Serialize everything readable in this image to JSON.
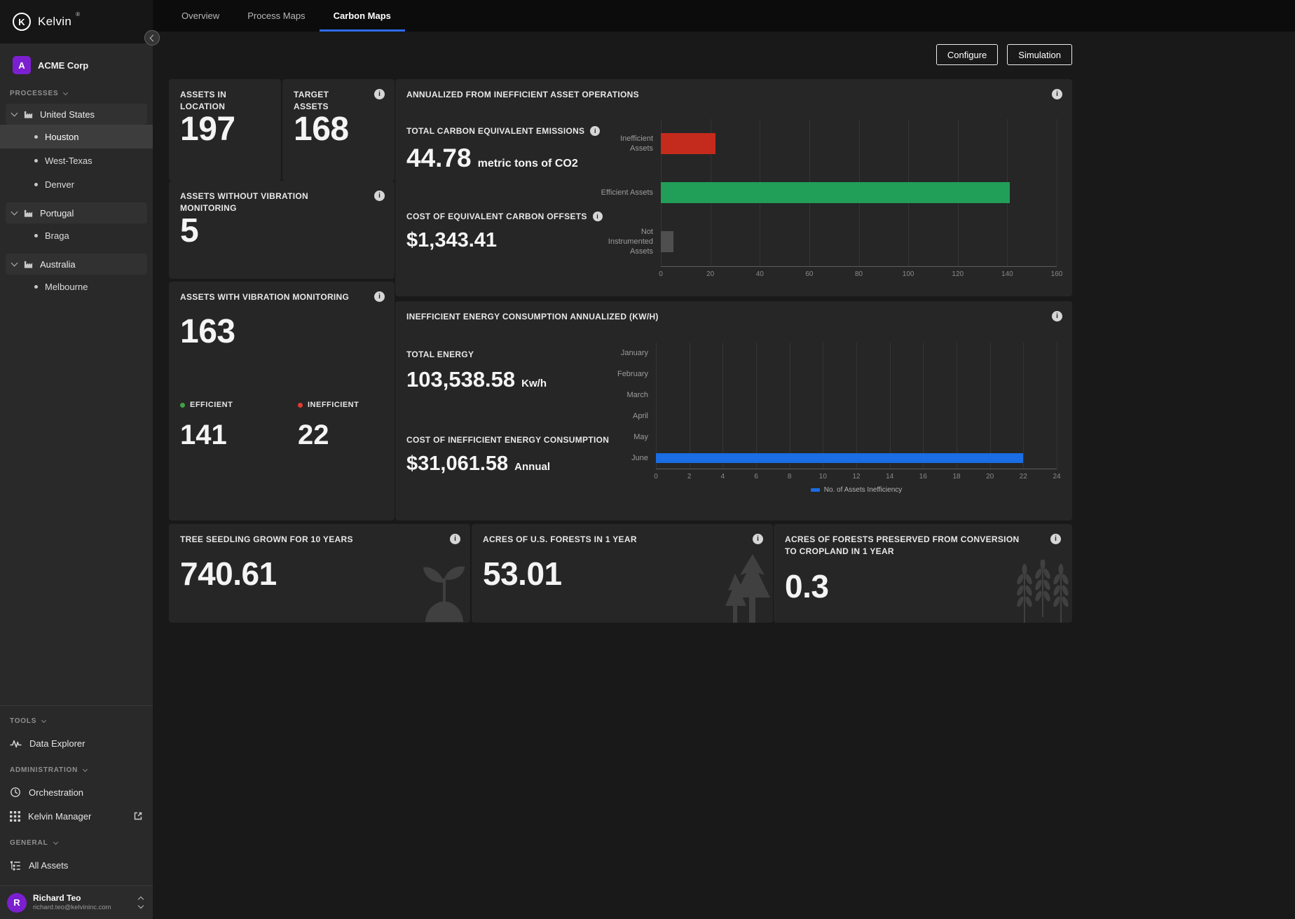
{
  "brand": {
    "logo_letter": "K",
    "logo_text": "Kelvin",
    "logo_mark": "®"
  },
  "org": {
    "avatar_letter": "A",
    "name": "ACME Corp"
  },
  "sidebar": {
    "sections": {
      "processes_label": "PROCESSES",
      "tools_label": "TOOLS",
      "administration_label": "ADMINISTRATION",
      "general_label": "GENERAL"
    },
    "tree": [
      {
        "label": "United States",
        "children": [
          "Houston",
          "West-Texas",
          "Denver"
        ]
      },
      {
        "label": "Portugal",
        "children": [
          "Braga"
        ]
      },
      {
        "label": "Australia",
        "children": [
          "Melbourne"
        ]
      }
    ],
    "selected": "Houston",
    "tools": [
      {
        "label": "Data Explorer"
      }
    ],
    "administration": [
      {
        "label": "Orchestration"
      },
      {
        "label": "Kelvin Manager"
      }
    ],
    "general": [
      {
        "label": "All Assets"
      }
    ],
    "user": {
      "avatar_letter": "R",
      "name": "Richard Teo",
      "email": "richard.teo@kelvininc.com"
    }
  },
  "tabs": [
    {
      "label": "Overview"
    },
    {
      "label": "Process Maps"
    },
    {
      "label": "Carbon Maps"
    }
  ],
  "actions": {
    "configure": "Configure",
    "simulation": "Simulation"
  },
  "cards": {
    "assets_in_location": {
      "title": "ASSETS IN LOCATION",
      "value": "197"
    },
    "target_assets": {
      "title": "TARGET ASSETS",
      "value": "168"
    },
    "without_vibration": {
      "title": "ASSETS WITHOUT VIBRATION MONITORING",
      "value": "5"
    },
    "with_vibration": {
      "title": "ASSETS WITH VIBRATION MONITORING",
      "value": "163",
      "efficient_label": "EFFICIENT",
      "efficient_value": "141",
      "inefficient_label": "INEFFICIENT",
      "inefficient_value": "22"
    },
    "annualized": {
      "title": "ANNUALIZED FROM INEFFICIENT ASSET OPERATIONS",
      "emissions_label": "TOTAL CARBON EQUIVALENT EMISSIONS",
      "emissions_value": "44.78",
      "emissions_unit": "metric tons of CO2",
      "offsets_label": "COST OF EQUIVALENT CARBON OFFSETS",
      "offsets_value": "$1,343.41"
    },
    "energy": {
      "title": "INEFFICIENT ENERGY CONSUMPTION ANNUALIZED (KW/H)",
      "total_label": "TOTAL ENERGY",
      "total_value": "103,538.58",
      "total_unit": "Kw/h",
      "cost_label": "COST OF INEFFICIENT ENERGY CONSUMPTION",
      "cost_value": "$31,061.58",
      "cost_unit": "Annual"
    },
    "tree_seedling": {
      "title": "TREE SEEDLING GROWN FOR 10 YEARS",
      "value": "740.61"
    },
    "acres_forests": {
      "title": "ACRES OF U.S. FORESTS IN 1 YEAR",
      "value": "53.01"
    },
    "acres_preserved": {
      "title": "ACRES OF FORESTS PRESERVED FROM CONVERSION TO CROPLAND IN 1 YEAR",
      "value": "0.3"
    }
  },
  "chart_data": [
    {
      "id": "emissions",
      "type": "bar",
      "orientation": "horizontal",
      "categories": [
        "Inefficient Assets",
        "Efficient Assets",
        "Not Instrumented Assets"
      ],
      "values": [
        22,
        141,
        5
      ],
      "colors": [
        "#c52b1c",
        "#219e58",
        "#4f4f4f"
      ],
      "xlim": [
        0,
        160
      ],
      "xticks": [
        0,
        20,
        40,
        60,
        80,
        100,
        120,
        140,
        160
      ],
      "grid": true
    },
    {
      "id": "energy",
      "type": "bar",
      "orientation": "horizontal",
      "categories": [
        "January",
        "February",
        "March",
        "April",
        "May",
        "June"
      ],
      "values": [
        0,
        0,
        0,
        0,
        0,
        22
      ],
      "colors": [
        "#1a6de4"
      ],
      "xlim": [
        0,
        24
      ],
      "xticks": [
        0,
        2,
        4,
        6,
        8,
        10,
        12,
        14,
        16,
        18,
        20,
        22,
        24
      ],
      "grid": true,
      "legend": [
        {
          "label": "No. of Assets Inefficiency",
          "color": "#1a6de4"
        }
      ]
    }
  ]
}
